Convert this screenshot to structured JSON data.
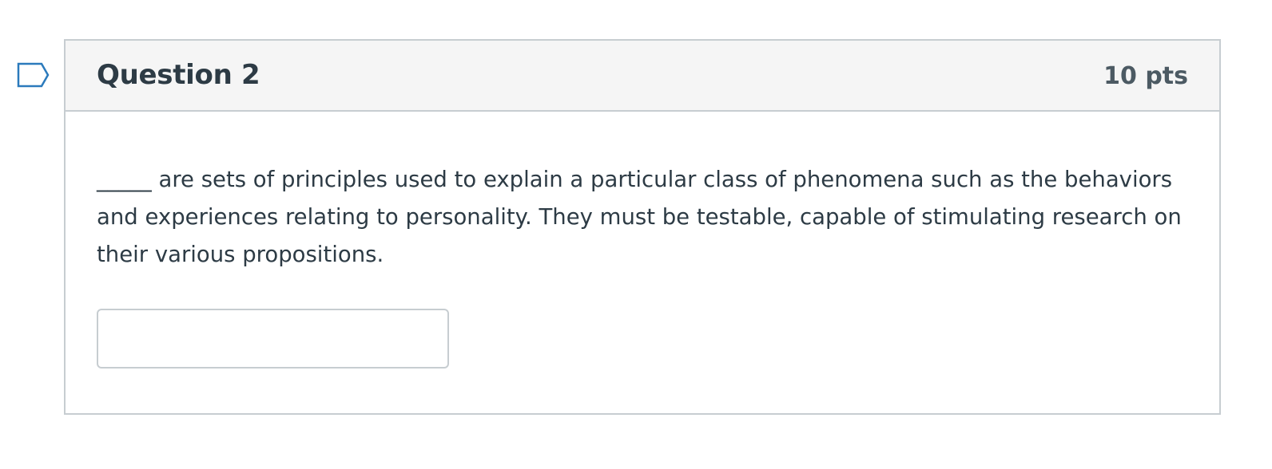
{
  "question": {
    "title": "Question 2",
    "points": "10 pts",
    "text": "_____ are sets of principles used to explain a particular class of phenomena such as the behaviors and experiences relating to personality. They must be testable, capable of stimulating research on their various propositions.",
    "answer_value": ""
  },
  "flag": {
    "icon": "flag-bookmark-icon",
    "color": "#2b7abc"
  },
  "colors": {
    "header_background": "#f5f5f5",
    "border": "#c7cdd1",
    "text": "#2d3b45"
  }
}
